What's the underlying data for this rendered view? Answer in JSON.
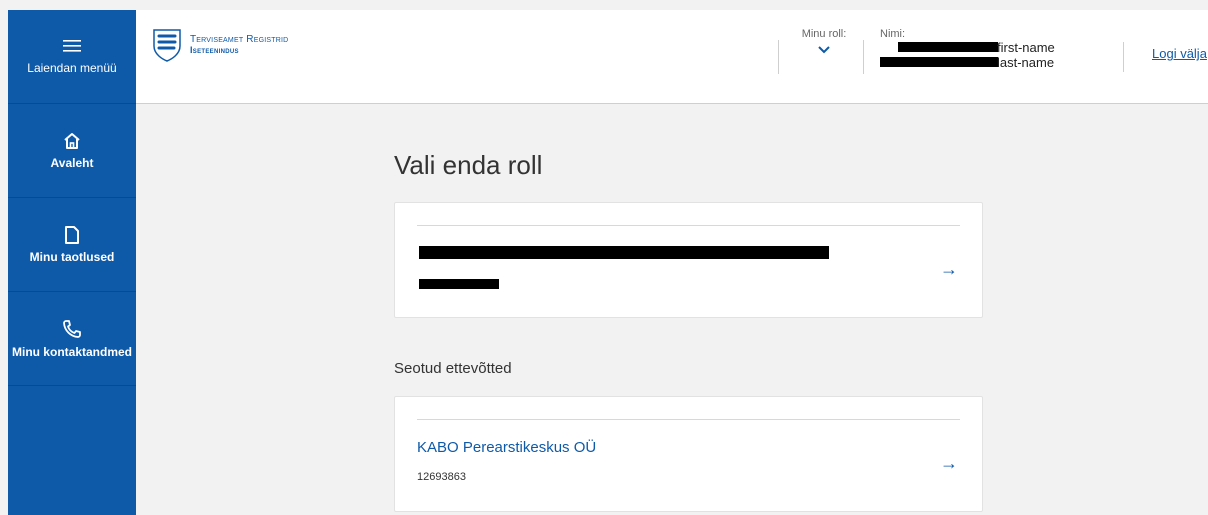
{
  "sidebar": {
    "menu_label": "Laiendan menüü",
    "items": [
      {
        "label": "Avaleht",
        "icon": "home-icon"
      },
      {
        "label": "Minu taotlused",
        "icon": "document-icon"
      },
      {
        "label": "Minu kontaktandmed",
        "icon": "phone-icon"
      }
    ]
  },
  "header": {
    "logo_line1": "Terviseamet Registrid",
    "logo_line2": "Iseteenindus",
    "role_label": "Minu roll:",
    "name_label": "Nimi:",
    "first_name_suffix": "first-name",
    "last_name_suffix": "last-name",
    "logout_label": "Logi välja"
  },
  "main": {
    "title": "Vali enda roll",
    "section_label": "Seotud ettevõtted",
    "companies": [
      {
        "name": "KABO Perearstikeskus OÜ",
        "code": "12693863"
      }
    ]
  },
  "colors": {
    "brand": "#0f5aa8",
    "background": "#f2f2f2"
  }
}
